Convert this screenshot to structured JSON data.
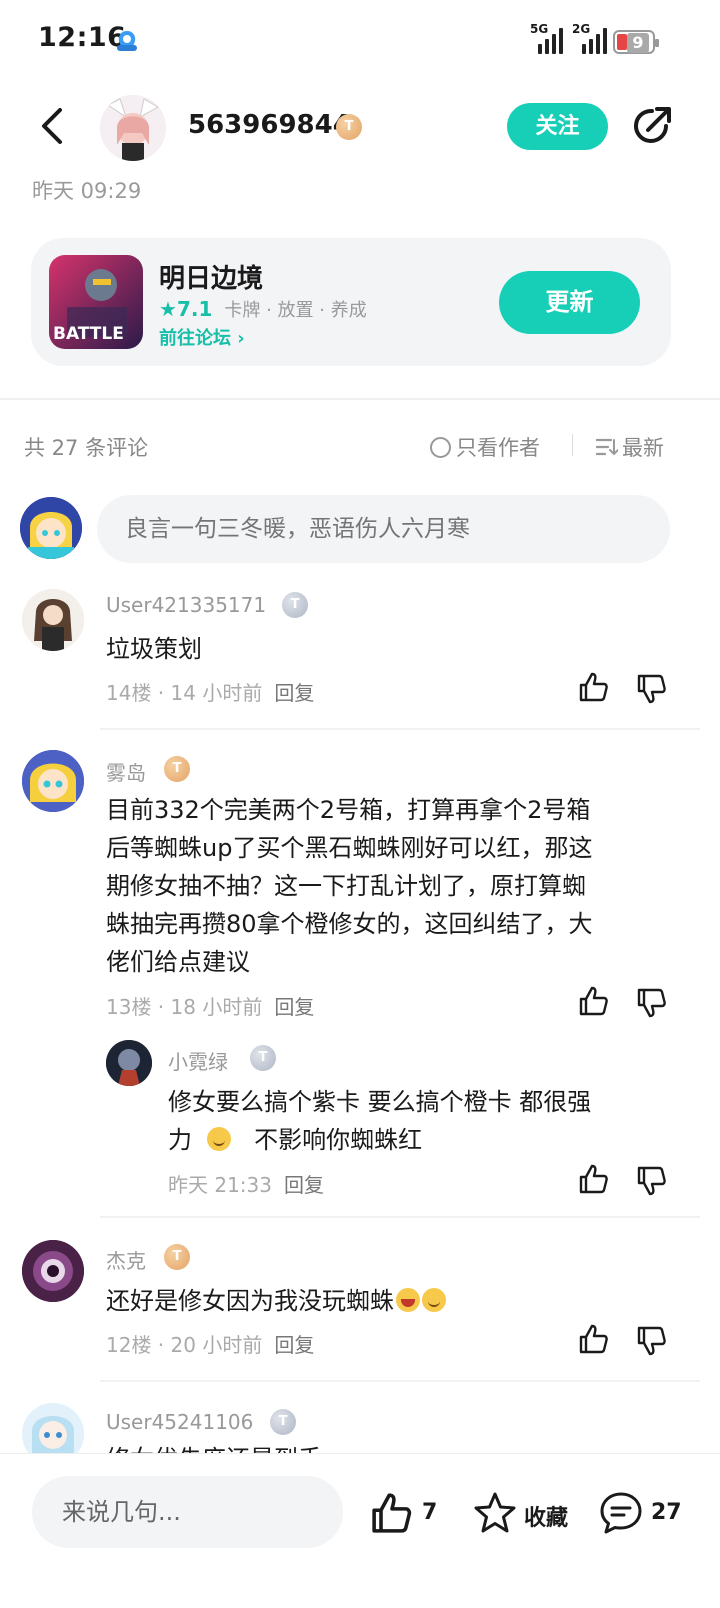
{
  "status_bar": {
    "time": "12:16",
    "net1": "5G",
    "net2": "2G",
    "battery": "9"
  },
  "header": {
    "author_name": "563969844",
    "author_level": "T",
    "follow_label": "关注",
    "post_time": "昨天 09:29"
  },
  "game": {
    "name": "明日边境",
    "score": "7.1",
    "tags": "卡牌 · 放置 · 养成",
    "forum_label": "前往论坛",
    "update_label": "更新",
    "icon_text": "BATTLE"
  },
  "comment_bar": {
    "count": "共 27 条评论",
    "only_author": "只看作者",
    "sort": "最新",
    "placeholder": "良言一句三冬暖，恶语伤人六月寒"
  },
  "comments": [
    {
      "user": "User421335171",
      "text": "垃圾策划",
      "meta": "14楼 · 14 小时前",
      "reply": "回复"
    },
    {
      "user": "雾岛",
      "text_lines": [
        "目前332个完美两个2号箱，打算再拿个2号箱",
        "后等蜘蛛up了买个黑石蜘蛛刚好可以红，那这",
        "期修女抽不抽？这一下打乱计划了，原打算蜘",
        "蛛抽完再攒80拿个橙修女的，这回纠结了，大",
        "佬们给点建议"
      ],
      "meta": "13楼 · 18 小时前",
      "reply": "回复",
      "sub_reply": {
        "user": "小霓绿",
        "line1": "修女要么搞个紫卡  要么搞个橙卡  都很强",
        "line2_a": "力",
        "line2_b": "不影响你蜘蛛红",
        "meta": "昨天 21:33",
        "reply": "回复"
      }
    },
    {
      "user": "杰克",
      "text": "还好是修女因为我没玩蜘蛛",
      "meta": "12楼 · 20 小时前",
      "reply": "回复"
    },
    {
      "user": "User45241106",
      "text": "修女优先度还是到手"
    }
  ],
  "bottom": {
    "say_placeholder": "来说几句...",
    "likes": "7",
    "favorite_label": "收藏",
    "comments": "27"
  }
}
